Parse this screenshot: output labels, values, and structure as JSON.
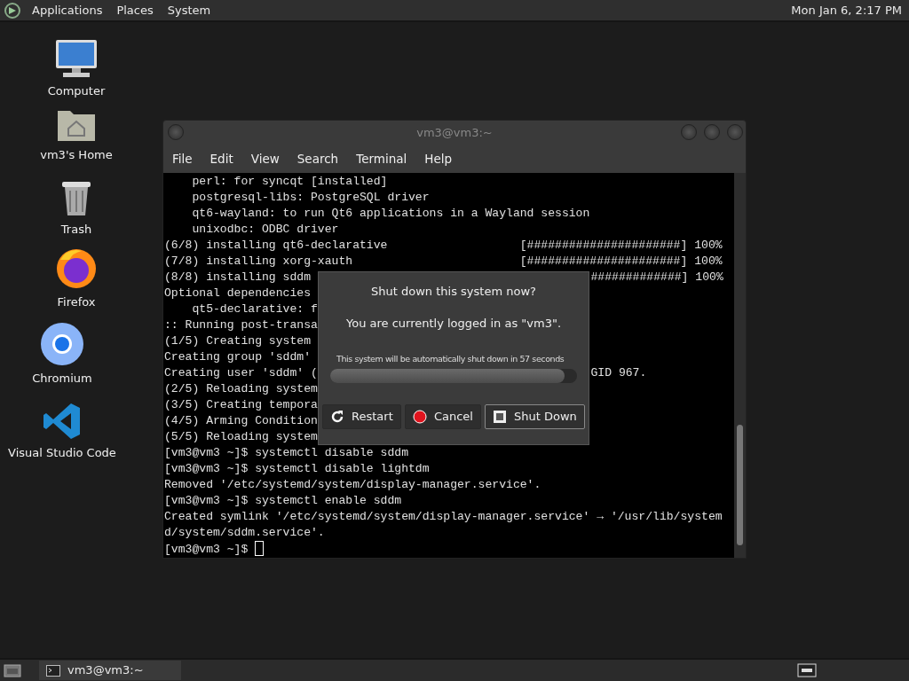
{
  "top_panel": {
    "menus": [
      "Applications",
      "Places",
      "System"
    ],
    "clock": "Mon Jan  6,  2:17 PM"
  },
  "desktop_icons": [
    {
      "kind": "computer",
      "label": "Computer"
    },
    {
      "kind": "home",
      "label": "vm3's Home"
    },
    {
      "kind": "trash",
      "label": "Trash"
    },
    {
      "kind": "firefox",
      "label": "Firefox"
    },
    {
      "kind": "chromium",
      "label": "Chromium"
    },
    {
      "kind": "vscode",
      "label": "Visual Studio Code"
    }
  ],
  "terminal": {
    "title": "vm3@vm3:~",
    "menu": [
      "File",
      "Edit",
      "View",
      "Search",
      "Terminal",
      "Help"
    ],
    "lines": [
      {
        "text": "    perl: for syncqt [installed]"
      },
      {
        "text": "    postgresql-libs: PostgreSQL driver"
      },
      {
        "text": "    qt6-wayland: to run Qt6 applications in a Wayland session"
      },
      {
        "text": "    unixodbc: ODBC driver"
      },
      {
        "text": "(6/8) installing qt6-declarative                   [######################] 100%"
      },
      {
        "text": "(7/8) installing xorg-xauth                        [######################] 100%"
      },
      {
        "text": "(8/8) installing sddm",
        "right": "#############] 100%"
      },
      {
        "text": "Optional dependencies"
      },
      {
        "text": "    qt5-declarative: f"
      },
      {
        "text": ":: Running post-transa"
      },
      {
        "text": "(1/5) Creating system"
      },
      {
        "text": "Creating group 'sddm'"
      },
      {
        "text": "Creating user 'sddm' (",
        "right": "GID 967."
      },
      {
        "text": "(2/5) Reloading system"
      },
      {
        "text": "(3/5) Creating tempora"
      },
      {
        "text": "(4/5) Arming Condition"
      },
      {
        "text": "(5/5) Reloading system"
      },
      {
        "text": "[vm3@vm3 ~]$ systemctl disable sddm"
      },
      {
        "text": "[vm3@vm3 ~]$ systemctl disable lightdm"
      },
      {
        "text": "Removed '/etc/systemd/system/display-manager.service'."
      },
      {
        "text": "[vm3@vm3 ~]$ systemctl enable sddm"
      },
      {
        "text": "Created symlink '/etc/systemd/system/display-manager.service' → '/usr/lib/system"
      },
      {
        "text": "d/system/sddm.service'."
      },
      {
        "text": "[vm3@vm3 ~]$ ",
        "cursor": true
      }
    ]
  },
  "dialog": {
    "question": "Shut down this system now?",
    "info": "You are currently logged in as \"vm3\".",
    "countdown": "This system will be automatically shut down in 57 seconds",
    "level": 0.95,
    "buttons": [
      {
        "kind": "restart",
        "label": "Restart",
        "selected": false
      },
      {
        "kind": "cancel",
        "label": "Cancel",
        "selected": false
      },
      {
        "kind": "shutdown",
        "label": "Shut Down",
        "selected": true
      }
    ]
  },
  "taskbar": {
    "tasks": [
      {
        "label": "vm3@vm3:~"
      }
    ]
  }
}
